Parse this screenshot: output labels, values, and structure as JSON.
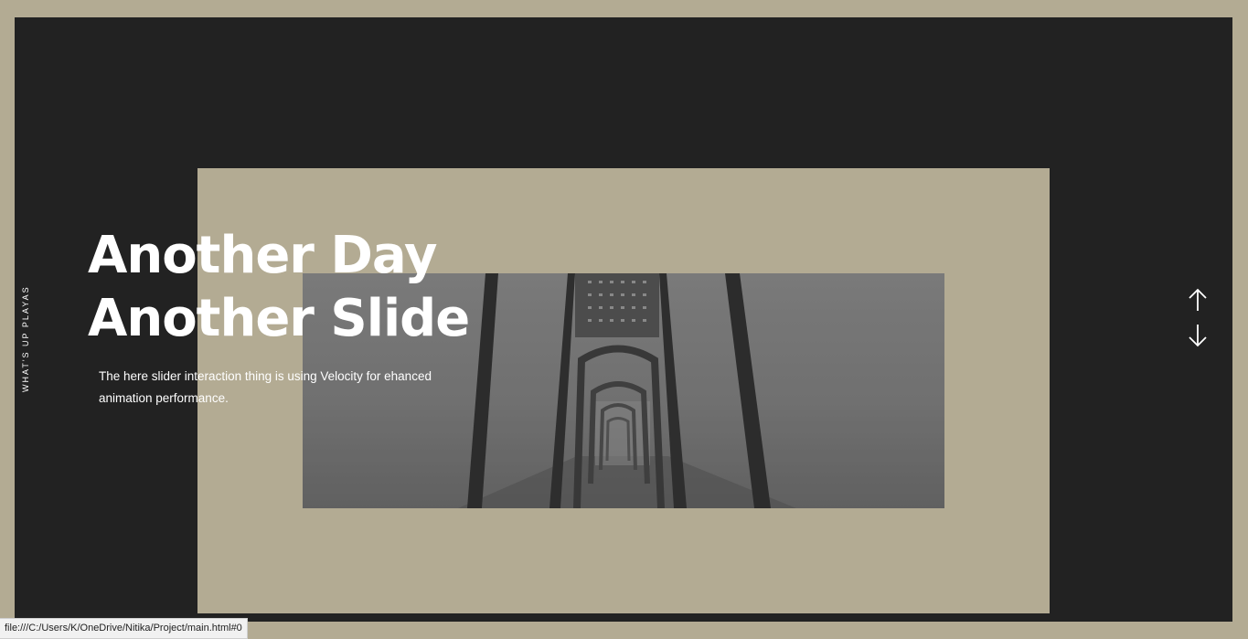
{
  "side_caption": "WHAT'S UP PLAYAS",
  "hero": {
    "title_line1": "Another Day",
    "title_line2": "Another Slide",
    "description": "The here slider interaction thing is using Velocity for ehanced animation performance."
  },
  "navigation": {
    "up_icon": "arrow-up-icon",
    "down_icon": "arrow-down-icon"
  },
  "status_bar": {
    "url": "file:///C:/Users/K/OneDrive/Nitika/Project/main.html#0"
  },
  "colors": {
    "frame_background": "#222222",
    "accent_tan": "#b3ab93",
    "text": "#ffffff"
  }
}
